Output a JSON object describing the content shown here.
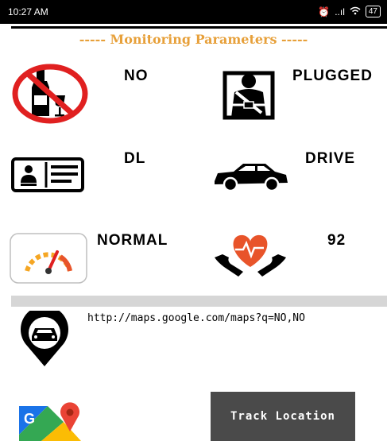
{
  "status_bar": {
    "time": "10:27 AM",
    "signal": "..ıl",
    "battery": "47"
  },
  "heading": "----- Monitoring Parameters -----",
  "parameters": {
    "alcohol": {
      "value": "NO",
      "icon": "no-alcohol-icon"
    },
    "seatbelt": {
      "value": "PLUGGED",
      "icon": "seatbelt-icon"
    },
    "license": {
      "value": "DL",
      "icon": "driver-license-icon"
    },
    "vehicle_mode": {
      "value": "DRIVE",
      "icon": "car-icon"
    },
    "speed": {
      "value": "NORMAL",
      "icon": "speedometer-icon"
    },
    "heart_rate": {
      "value": "92",
      "icon": "heart-pulse-icon"
    }
  },
  "location": {
    "link": "http://maps.google.com/maps?q=NO,NO",
    "icon": "car-location-pin-icon"
  },
  "maps_icon": "google-maps-icon",
  "track_button": {
    "label": "Track Location"
  },
  "colors": {
    "accent": "#e7a03a",
    "prohibition_red": "#e02020",
    "heart_orange": "#e8542a",
    "button_gray": "#4a4a4a"
  }
}
